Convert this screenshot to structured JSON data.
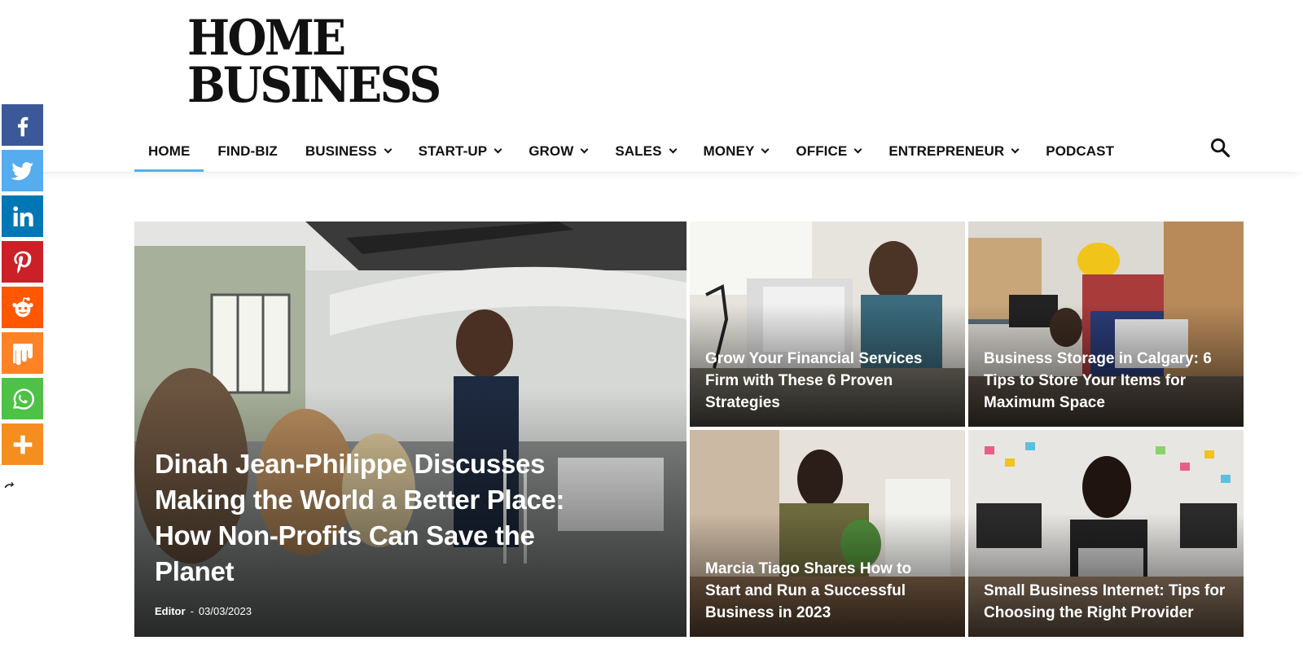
{
  "logo": {
    "line1": "HOME",
    "line2": "BUSINESS"
  },
  "nav": {
    "items": [
      {
        "label": "HOME",
        "has_dropdown": false,
        "active": true
      },
      {
        "label": "FIND-BIZ",
        "has_dropdown": false
      },
      {
        "label": "BUSINESS",
        "has_dropdown": true
      },
      {
        "label": "START-UP",
        "has_dropdown": true
      },
      {
        "label": "GROW",
        "has_dropdown": true
      },
      {
        "label": "SALES",
        "has_dropdown": true
      },
      {
        "label": "MONEY",
        "has_dropdown": true
      },
      {
        "label": "OFFICE",
        "has_dropdown": true
      },
      {
        "label": "ENTREPRENEUR",
        "has_dropdown": true
      },
      {
        "label": "PODCAST",
        "has_dropdown": false
      }
    ],
    "search_icon": "search-icon",
    "active_color": "#4db2ec"
  },
  "social": [
    {
      "name": "facebook",
      "color": "#3b5998"
    },
    {
      "name": "twitter",
      "color": "#55acee"
    },
    {
      "name": "linkedin",
      "color": "#0077b5"
    },
    {
      "name": "pinterest",
      "color": "#cb2027"
    },
    {
      "name": "reddit",
      "color": "#ff5700"
    },
    {
      "name": "mix",
      "color": "#ff8226"
    },
    {
      "name": "whatsapp",
      "color": "#4dc247"
    },
    {
      "name": "more",
      "color": "#f58e1f"
    }
  ],
  "featured": {
    "title": "Dinah Jean-Philippe Discusses Making the World a Better Place: How Non-Profits Can Save the Planet",
    "author": "Editor",
    "separator": "-",
    "date": "03/03/2023"
  },
  "tiles": [
    {
      "title": "Grow Your Financial Services Firm with These 6 Proven Strategies"
    },
    {
      "title": "Business Storage in Calgary: 6 Tips to Store Your Items for Maximum Space"
    },
    {
      "title": "Marcia Tiago Shares How to Start and Run a Successful Business in 2023"
    },
    {
      "title": "Small Business Internet: Tips for Choosing the Right Provider"
    }
  ]
}
